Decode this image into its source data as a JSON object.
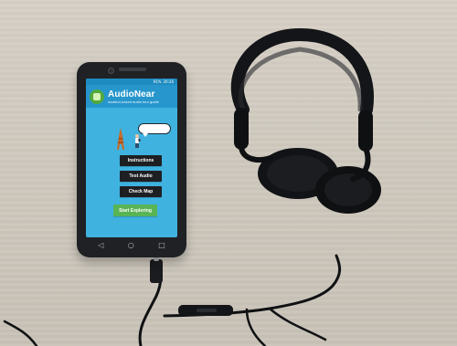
{
  "phone": {
    "status": {
      "time": "20:26",
      "battery": "91%"
    },
    "app": {
      "title": "AudioNear",
      "subtitle": "location-based audio tour guide",
      "buttons": [
        {
          "label": "Instructions"
        },
        {
          "label": "Test Audio"
        },
        {
          "label": "Check Map"
        },
        {
          "label": "Start Exploring"
        }
      ]
    },
    "nav": {
      "back_icon": "back-triangle-icon",
      "home_icon": "home-circle-icon",
      "recents_icon": "recents-square-icon"
    }
  },
  "colors": {
    "screen_bg": "#3fb2df",
    "header_bg": "#2796cc",
    "dark_button": "#1e1f22",
    "primary_button": "#58b455"
  }
}
